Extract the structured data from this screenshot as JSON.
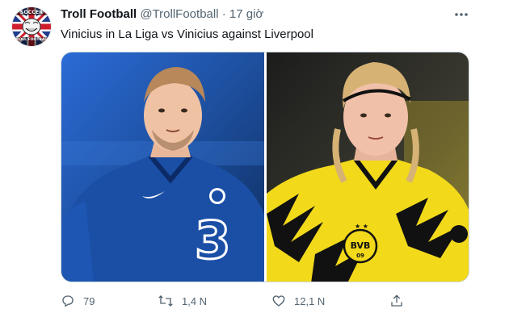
{
  "tweet": {
    "author_name": "Troll Football",
    "handle": "@TrollFootball",
    "separator": "·",
    "time": "17 giờ",
    "text": "Vinicius in La Liga vs Vinicius against Liverpool",
    "avatar": {
      "top_text": "SOCCER",
      "bottom_text": "TROLL FOOTBALL",
      "icon": "troll-face-union-jack"
    },
    "media": [
      {
        "description_icon": "player-blue-kit-photo",
        "kit_color": "#1b4fa6"
      },
      {
        "description_icon": "player-yellow-kit-photo",
        "kit_color": "#f2d91a",
        "badge_text": "BVB",
        "badge_sub": "09"
      }
    ],
    "actions": {
      "reply_count": "79",
      "retweet_count": "1,4 N",
      "like_count": "12,1 N",
      "share_icon": "share-icon"
    }
  },
  "colors": {
    "text": "#0f1419",
    "secondary": "#536471",
    "border": "#cfd9de"
  }
}
